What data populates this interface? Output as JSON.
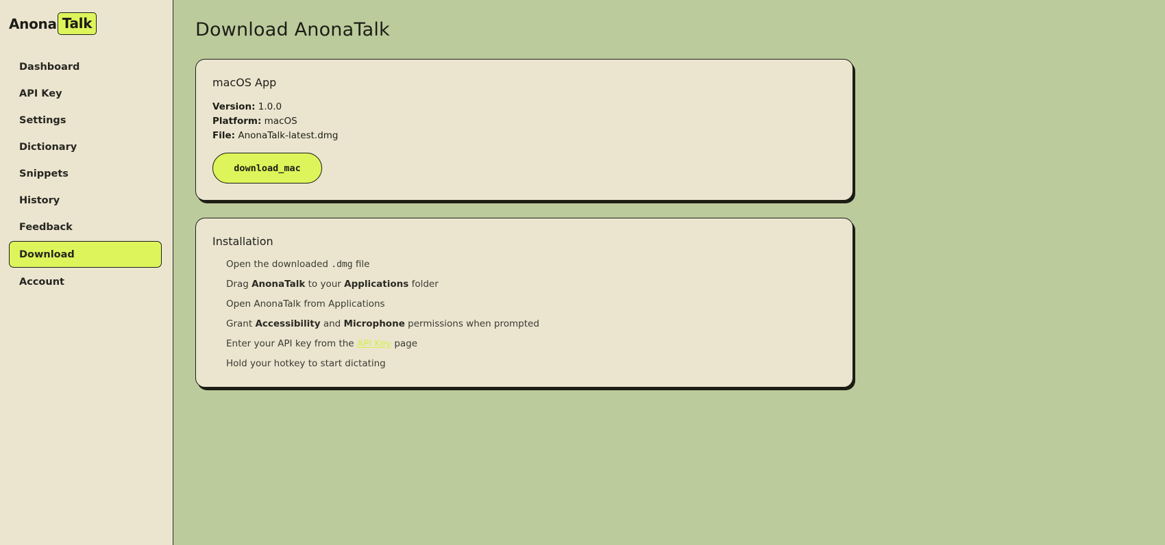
{
  "brand": {
    "part1": "Anona",
    "part2": "Talk"
  },
  "nav": {
    "items": [
      {
        "label": "Dashboard",
        "active": false
      },
      {
        "label": "API Key",
        "active": false
      },
      {
        "label": "Settings",
        "active": false
      },
      {
        "label": "Dictionary",
        "active": false
      },
      {
        "label": "Snippets",
        "active": false
      },
      {
        "label": "History",
        "active": false
      },
      {
        "label": "Feedback",
        "active": false
      },
      {
        "label": "Download",
        "active": true
      },
      {
        "label": "Account",
        "active": false
      }
    ]
  },
  "page": {
    "title": "Download AnonaTalk"
  },
  "mac_card": {
    "title": "macOS App",
    "version_label": "Version:",
    "version": "1.0.0",
    "platform_label": "Platform:",
    "platform": "macOS",
    "file_label": "File:",
    "file": "AnonaTalk-latest.dmg",
    "button": "download_mac"
  },
  "install_card": {
    "title": "Installation",
    "step1": {
      "pre": "Open the downloaded ",
      "code": ".dmg",
      "post": " file"
    },
    "step2": {
      "pre": "Drag ",
      "b1": "AnonaTalk",
      "mid": " to your ",
      "b2": "Applications",
      "post": " folder"
    },
    "step3": {
      "text": "Open AnonaTalk from Applications"
    },
    "step4": {
      "pre": "Grant ",
      "b1": "Accessibility",
      "mid": " and ",
      "b2": "Microphone",
      "post": " permissions when prompted"
    },
    "step5": {
      "pre": "Enter your API key from the ",
      "link": "API Key",
      "post": " page"
    },
    "step6": {
      "text": "Hold your hotkey to start dictating"
    }
  },
  "colors": {
    "accent": "#ddf55a",
    "background": "#bccb9c",
    "surface": "#ebe5d0",
    "ink": "#1d1d16"
  }
}
